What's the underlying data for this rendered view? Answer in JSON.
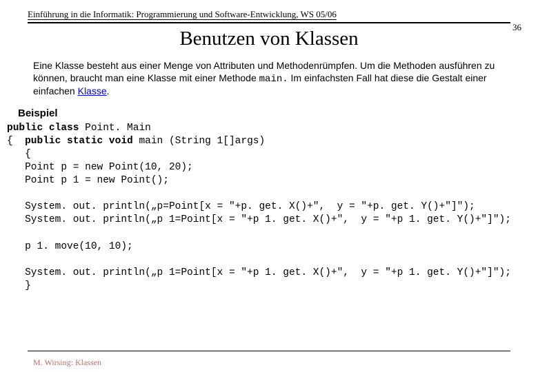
{
  "header": {
    "course": "Einführung in die Informatik: Programmierung und Software-Entwicklung, WS 05/06",
    "page_number": "36"
  },
  "title": "Benutzen von Klassen",
  "intro": {
    "text_before_mono": "Eine Klasse besteht aus einer Menge von Attributen und Methodenrümpfen. Um die Methoden ausführen zu können, braucht man eine Klasse mit einer Methode ",
    "mono": "main.",
    "text_after_mono": " Im einfachsten Fall hat diese die Gestalt einer einfachen ",
    "link_text": "Klasse",
    "period": "."
  },
  "section_heading": "Beispiel",
  "code": {
    "kw1": "public class ",
    "cls": "Point. Main",
    "brace_open": "{  ",
    "kw2": "public static void ",
    "main_sig": "main (String 1[]args)",
    "body": "\n   {\n   Point p = new Point(10, 20);\n   Point p 1 = new Point();\n\n   System. out. println(„p=Point[x = \"+p. get. X()+\",  y = \"+p. get. Y()+\"]\");\n   System. out. println(„p 1=Point[x = \"+p 1. get. X()+\",  y = \"+p 1. get. Y()+\"]\");\n\n   p 1. move(10, 10);\n\n   System. out. println(„p 1=Point[x = \"+p 1. get. X()+\",  y = \"+p 1. get. Y()+\"]\");\n   }"
  },
  "footer": "M. Wirsing: Klassen"
}
